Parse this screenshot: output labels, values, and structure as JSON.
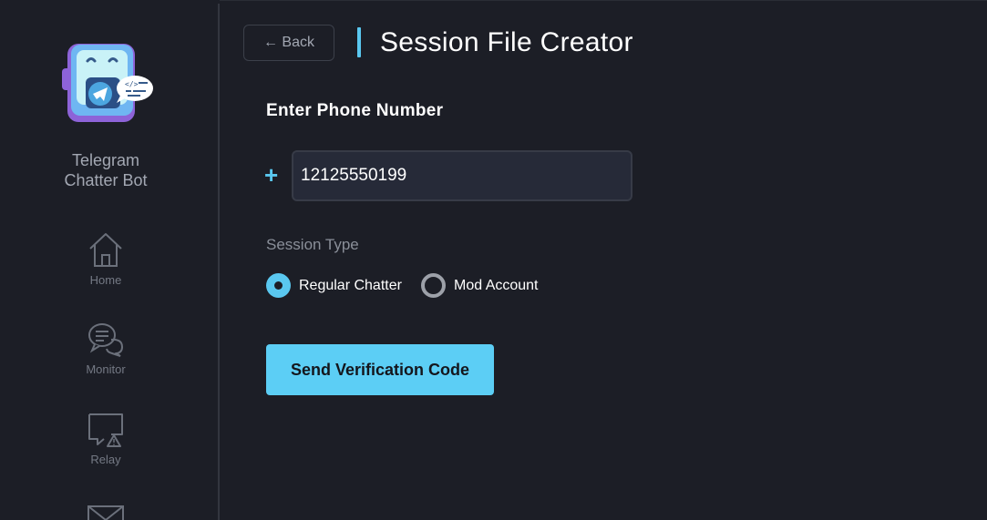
{
  "app": {
    "name_line1": "Telegram",
    "name_line2": "Chatter Bot"
  },
  "sidebar": {
    "items": [
      {
        "label": "Home",
        "icon": "home-icon"
      },
      {
        "label": "Monitor",
        "icon": "chat-bubbles-icon"
      },
      {
        "label": "Relay",
        "icon": "warning-message-icon"
      },
      {
        "label": "",
        "icon": "mail-icon"
      }
    ]
  },
  "header": {
    "back_label": "← Back",
    "title": "Session File Creator"
  },
  "form": {
    "phone_section_label": "Enter Phone Number",
    "phone_prefix": "+",
    "phone_value": "12125550199",
    "session_type_label": "Session Type",
    "options": [
      {
        "label": "Regular Chatter",
        "selected": true
      },
      {
        "label": "Mod Account",
        "selected": false
      }
    ],
    "submit_label": "Send Verification Code"
  },
  "colors": {
    "accent": "#5ac8f0",
    "background": "#1c1e26",
    "input_bg": "#262a38",
    "button": "#5ccef5"
  }
}
